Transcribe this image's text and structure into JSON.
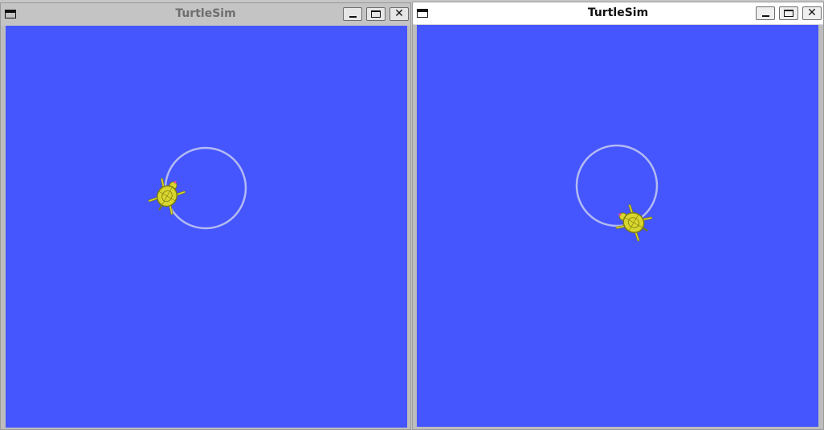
{
  "windows": [
    {
      "title": "TurtleSim",
      "active": false,
      "icons": {
        "menu": "window-menu-icon",
        "minimize": "minimize-icon",
        "maximize": "maximize-icon",
        "close": "close-icon"
      },
      "close_glyph": "✕",
      "turtle": {
        "heading_deg": 30
      }
    },
    {
      "title": "TurtleSim",
      "active": true,
      "icons": {
        "menu": "window-menu-icon",
        "minimize": "minimize-icon",
        "maximize": "maximize-icon",
        "close": "close-icon"
      },
      "close_glyph": "✕",
      "turtle": {
        "heading_deg": -60
      }
    }
  ],
  "colors": {
    "canvas_background": "#4556ff",
    "pen_trail": "#b3baf2",
    "turtle_shell": "#d8d62e",
    "turtle_outline": "#7a7a10",
    "turtle_pen_tip": "#e04fa6"
  }
}
